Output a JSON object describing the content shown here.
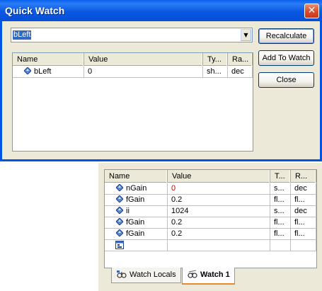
{
  "quick_watch": {
    "title": "Quick Watch",
    "close_glyph": "✕",
    "expression": "bLeft",
    "buttons": {
      "recalculate": "Recalculate",
      "add_to_watch": "Add To Watch",
      "close": "Close"
    },
    "columns": [
      "Name",
      "Value",
      "Ty...",
      "Ra..."
    ],
    "rows": [
      {
        "name": "bLeft",
        "value": "0",
        "type": "sh...",
        "radix": "dec",
        "icon": "variable-icon"
      }
    ]
  },
  "watch_window": {
    "columns": [
      "Name",
      "Value",
      "T...",
      "R..."
    ],
    "rows": [
      {
        "name": "nGain",
        "value": "0",
        "type": "s...",
        "radix": "dec",
        "changed": true,
        "icon": "variable-icon"
      },
      {
        "name": "fGain",
        "value": "0.2",
        "type": "fl...",
        "radix": "fl...",
        "changed": false,
        "icon": "variable-icon"
      },
      {
        "name": "ii",
        "value": "1024",
        "type": "s...",
        "radix": "dec",
        "changed": false,
        "icon": "variable-icon"
      },
      {
        "name": "fGain",
        "value": "0.2",
        "type": "fl...",
        "radix": "fl...",
        "changed": false,
        "icon": "variable-icon"
      },
      {
        "name": "fGain",
        "value": "0.2",
        "type": "fl...",
        "radix": "fl...",
        "changed": false,
        "icon": "variable-icon"
      }
    ],
    "new_row_icon": "new-watch-icon",
    "tabs": [
      {
        "label": "Watch Locals",
        "icon": "watch-locals-icon",
        "active": false
      },
      {
        "label": "Watch 1",
        "icon": "watch-icon",
        "active": true
      }
    ]
  },
  "colors": {
    "title_bar": "#0a58e2",
    "dialog_bg": "#ece9d8",
    "selection": "#316ac5",
    "changed_value": "#c00000"
  }
}
